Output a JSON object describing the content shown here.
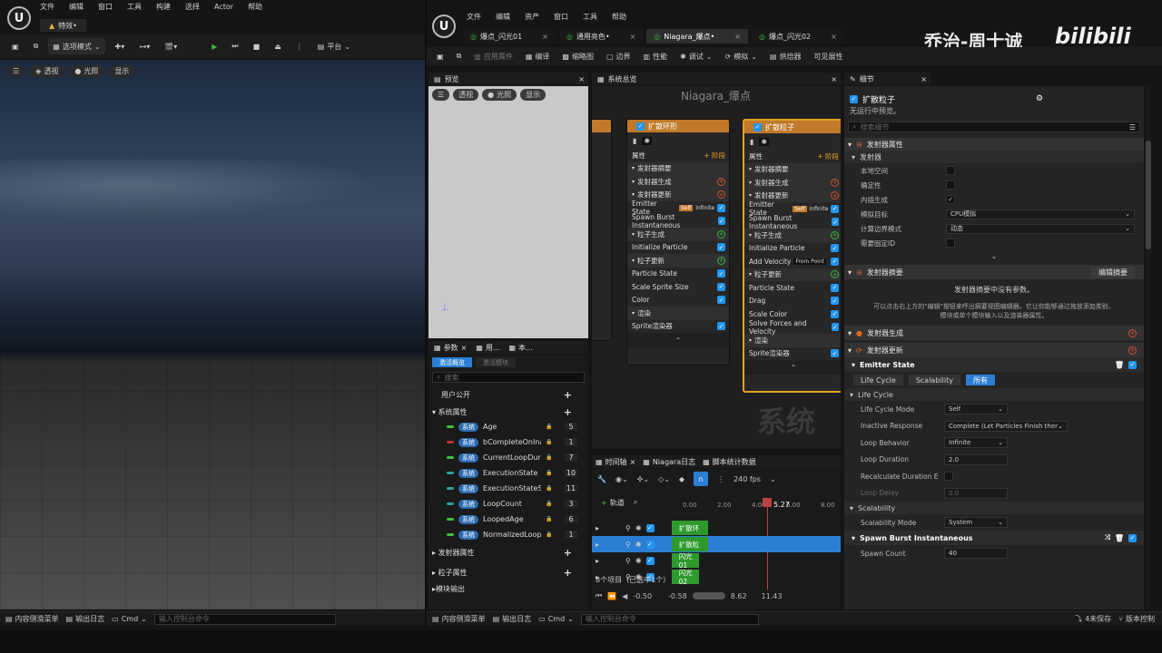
{
  "left": {
    "menu": [
      "文件",
      "编辑",
      "窗口",
      "工具",
      "构建",
      "选择",
      "Actor",
      "帮助"
    ],
    "tab": "特效•",
    "toolbar": {
      "mode": "选项模式",
      "platform": "平台"
    },
    "viewport": {
      "perspective": "透视",
      "lit": "光照",
      "show": "显示"
    },
    "status": {
      "drawer": "内容侧滑菜单",
      "log": "输出日志",
      "cmd": "Cmd",
      "cmd_placeholder": "输入控制台命令"
    }
  },
  "right": {
    "menu": [
      "文件",
      "编辑",
      "资产",
      "窗口",
      "工具",
      "帮助"
    ],
    "tabs": [
      "爆点_闪光01",
      "通用亮色•",
      "Niagara_爆点•",
      "爆点_闪光02"
    ],
    "watermark": "乔治-周士诚",
    "watermark_logo": "bilibili",
    "toolbar": {
      "apply": "应用属件",
      "compile": "编译",
      "thumb": "缩略图",
      "bounds": "边界",
      "perf": "性能",
      "debug": "调试",
      "sim": "模拟",
      "baker": "烘焙器",
      "visibility": "可见展性"
    },
    "preview": {
      "title": "预览",
      "perspective": "透视",
      "lit": "光照",
      "show": "显示"
    },
    "graph": {
      "title": "系统总览",
      "system_name": "Niagara_爆点",
      "system_watermark": "系统",
      "nodes": [
        {
          "title": "扩散环形",
          "stage": "阶段",
          "props": "属性",
          "rows": [
            "发射器摘要",
            "发射器生成",
            "发射器更新",
            "Emitter State",
            "Spawn Burst Instantaneous",
            "粒子生成",
            "Initialize Particle",
            "粒子更新",
            "Particle State",
            "Scale Sprite Size",
            "Color",
            "渲染",
            "Sprite渲染器"
          ],
          "badge": "Self",
          "badge2": "Infinite"
        },
        {
          "title": "扩散粒子",
          "stage": "阶段",
          "props": "属性",
          "rows": [
            "发射器摘要",
            "发射器生成",
            "发射器更新",
            "Emitter State",
            "Spawn Burst Instantaneous",
            "粒子生成",
            "Initialize Particle",
            "Add Velocity",
            "粒子更新",
            "Particle State",
            "Drag",
            "Scale Color",
            "Solve Forces and Velocity",
            "渲染",
            "Sprite渲染器"
          ],
          "badge": "Self",
          "badge2": "Infinite",
          "from": "From Point"
        }
      ]
    },
    "params": {
      "tabs": [
        "参数",
        "用...",
        "本..."
      ],
      "filter_active": "激活概览",
      "filter_other": "激活模块",
      "search": "搜索",
      "user": "用户公开",
      "system": "系统属性",
      "items": [
        {
          "tag": "系统",
          "name": "Age",
          "count": "5",
          "color": "#3ec03e"
        },
        {
          "tag": "系统",
          "name": "bCompleteOnInac",
          "count": "1",
          "color": "#c03030"
        },
        {
          "tag": "系统",
          "name": "CurrentLoopDura",
          "count": "7",
          "color": "#3ec03e"
        },
        {
          "tag": "系统",
          "name": "ExecutionState",
          "count": "10",
          "color": "#2aa0a0"
        },
        {
          "tag": "系统",
          "name": "ExecutionStateS",
          "count": "11",
          "color": "#2aa0a0"
        },
        {
          "tag": "系统",
          "name": "LoopCount",
          "count": "3",
          "color": "#2aa0a0"
        },
        {
          "tag": "系统",
          "name": "LoopedAge",
          "count": "6",
          "color": "#3ec03e"
        },
        {
          "tag": "系统",
          "name": "NormalizedLoopA",
          "count": "1",
          "color": "#3ec03e"
        }
      ],
      "emitter": "发射器属性",
      "particle": "粒子属性",
      "engine": "模块输出"
    },
    "timeline": {
      "tabs": [
        "时间轴",
        "Niagara日志",
        "脚本统计数据"
      ],
      "fps": "240 fps",
      "add_track": "轨道",
      "ticks": [
        "0.00",
        "2.00",
        "4.00",
        "6.00",
        "8.00"
      ],
      "current": "5.27",
      "tracks": [
        "扩散环",
        "扩散粒",
        "闪光01",
        "闪光02"
      ],
      "selected_info": "8个项目（已选中1个）",
      "range": [
        "-0.50",
        "-0.58",
        "8.62",
        "11.43"
      ]
    },
    "details": {
      "title": "细节",
      "emitter_name": "扩散粒子",
      "note": "无运行中预览。",
      "search": "搜索细节",
      "emitter_props": "发射器属性",
      "emitter": "发射器",
      "rows": [
        {
          "label": "本地空间",
          "type": "check",
          "value": false
        },
        {
          "label": "确定性",
          "type": "check",
          "value": false
        },
        {
          "label": "内插生成",
          "type": "check",
          "value": true
        },
        {
          "label": "模拟目标",
          "type": "select",
          "value": "CPU模拟"
        },
        {
          "label": "计算边界模式",
          "type": "select",
          "value": "动态"
        },
        {
          "label": "需要固定ID",
          "type": "check",
          "value": false
        }
      ],
      "summary": "发射器摘要",
      "edit_summary": "编辑摘要",
      "no_params": "发射器摘要中没有参数。",
      "hint1": "可以点击右上方的\"编辑\"按钮来呼出摘要视图编辑器。它让你能够通过拖放添加类别、",
      "hint2": "模块或单个模块输入以及渲染器属性。",
      "spawn": "发射器生成",
      "update": "发射器更新",
      "state": "Emitter State",
      "state_tabs": [
        "Life Cycle",
        "Scalability",
        "所有"
      ],
      "lifecycle": "Life Cycle",
      "lc_rows": [
        {
          "label": "Life Cycle Mode",
          "value": "Self"
        },
        {
          "label": "Inactive Response",
          "value": "Complete (Let Particles Finish then"
        },
        {
          "label": "Loop Behavior",
          "value": "Infinite"
        },
        {
          "label": "Loop Duration",
          "value": "2.0"
        },
        {
          "label": "Recalculate Duration Ea",
          "value": ""
        },
        {
          "label": "Loop Delay",
          "value": "0.0"
        }
      ],
      "scal": "Scalability",
      "scal_mode": "Scalability Mode",
      "scal_val": "System",
      "burst": "Spawn Burst Instantaneous",
      "spawn_count": "Spawn Count",
      "spawn_val": "40"
    },
    "status": {
      "drawer": "内容侧滑菜单",
      "log": "输出日志",
      "cmd": "Cmd",
      "cmd_placeholder": "输入控制台命令",
      "unsaved": "4未保存",
      "version": "版本控制"
    }
  }
}
